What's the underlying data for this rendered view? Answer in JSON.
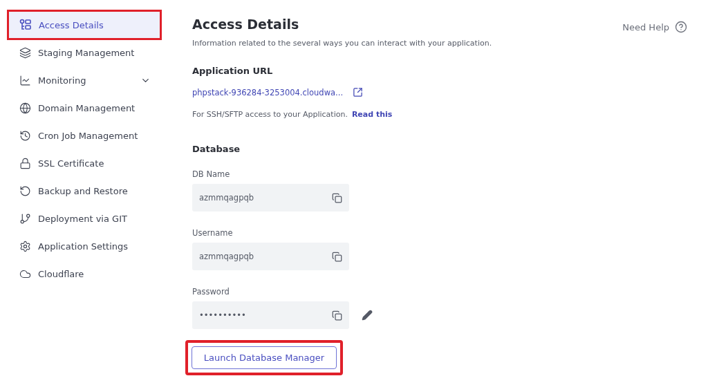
{
  "sidebar": {
    "items": [
      {
        "label": "Access Details",
        "selected": true,
        "highlighted": true
      },
      {
        "label": "Staging Management",
        "selected": false,
        "highlighted": false
      },
      {
        "label": "Monitoring",
        "selected": false,
        "highlighted": false,
        "expanded": false
      },
      {
        "label": "Domain Management",
        "selected": false,
        "highlighted": false
      },
      {
        "label": "Cron Job Management",
        "selected": false,
        "highlighted": false
      },
      {
        "label": "SSL Certificate",
        "selected": false,
        "highlighted": false
      },
      {
        "label": "Backup and Restore",
        "selected": false,
        "highlighted": false
      },
      {
        "label": "Deployment via GIT",
        "selected": false,
        "highlighted": false
      },
      {
        "label": "Application Settings",
        "selected": false,
        "highlighted": false
      },
      {
        "label": "Cloudflare",
        "selected": false,
        "highlighted": false
      }
    ]
  },
  "main": {
    "title": "Access Details",
    "subtitle": "Information related to the several ways you can interact with your application.",
    "help": "Need Help",
    "app_url": {
      "heading": "Application URL",
      "url": "phpstack-936284-3253004.cloudwa...",
      "ssh_note": "For SSH/SFTP access to your Application.",
      "ssh_link": "Read this"
    },
    "database": {
      "heading": "Database",
      "fields": [
        {
          "label": "DB Name",
          "value": "azmmqagpqb",
          "editable": false
        },
        {
          "label": "Username",
          "value": "azmmqagpqb",
          "editable": false
        },
        {
          "label": "Password",
          "value": "••••••••••",
          "editable": true
        }
      ],
      "button": {
        "label": "Launch Database Manager",
        "highlighted": true
      }
    }
  }
}
